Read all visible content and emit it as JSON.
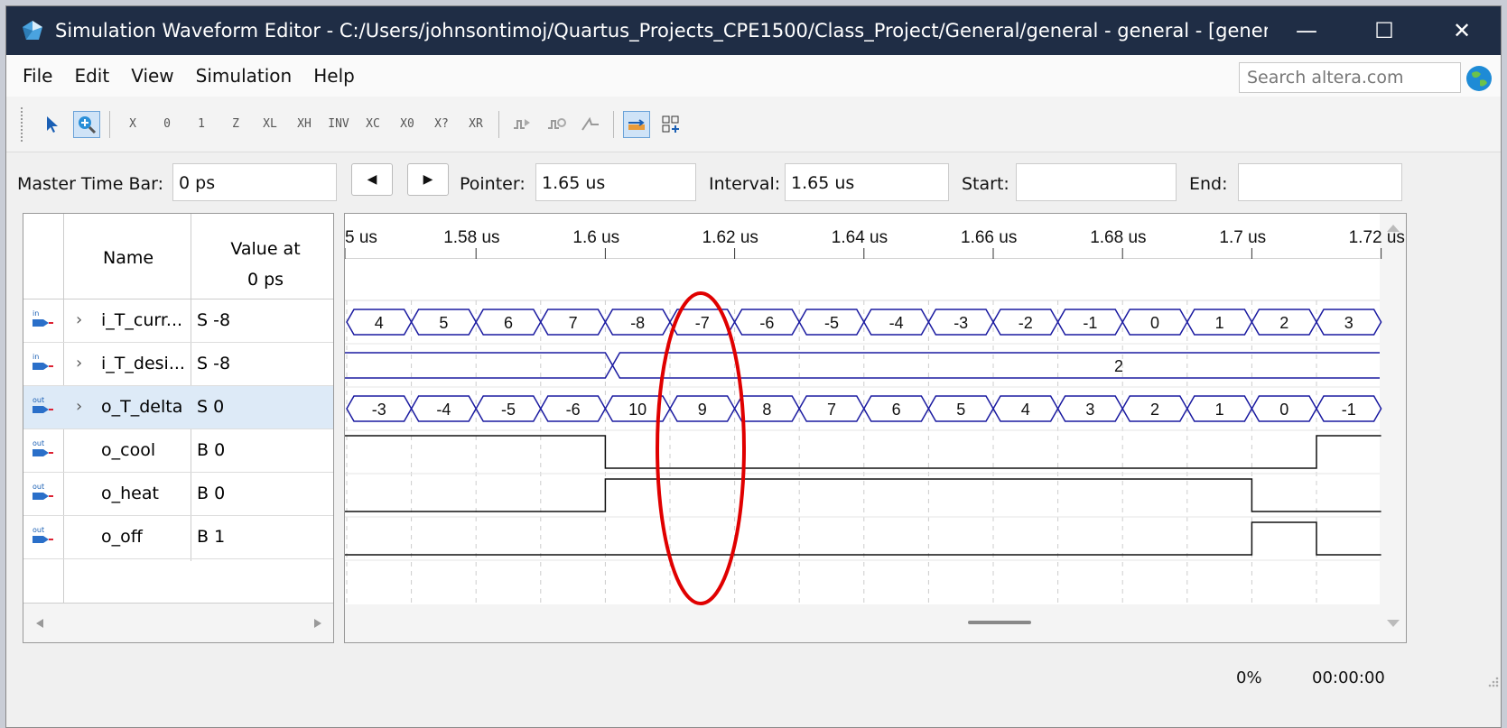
{
  "window": {
    "title": "Simulation Waveform Editor - C:/Users/johnsontimoj/Quartus_Projects_CPE1500/Class_Project/General/general - general - [general_...",
    "minimize": "—",
    "maximize": "☐",
    "close": "✕"
  },
  "menu": {
    "items": [
      "File",
      "Edit",
      "View",
      "Simulation",
      "Help"
    ],
    "search_placeholder": "Search altera.com"
  },
  "toolbar": {
    "buttons": [
      "pointer-tool",
      "zoom-tool",
      "X",
      "0",
      "1",
      "Z",
      "XL",
      "XH",
      "INV",
      "XC",
      "X0",
      "X?",
      "XR",
      "count-value",
      "clock",
      "random",
      "snap",
      "grid"
    ]
  },
  "timebar": {
    "master_label": "Master Time Bar:",
    "master_value": "0 ps",
    "prev": "◀",
    "next": "▶",
    "pointer_label": "Pointer:",
    "pointer_value": "1.65 us",
    "interval_label": "Interval:",
    "interval_value": "1.65 us",
    "start_label": "Start:",
    "start_value": "",
    "end_label": "End:",
    "end_value": ""
  },
  "table": {
    "col_name": "Name",
    "col_value_1": "Value at",
    "col_value_2": "0 ps",
    "rows": [
      {
        "dir": "in",
        "name": "i_T_curr...",
        "value": "S -8",
        "bus": true
      },
      {
        "dir": "in",
        "name": "i_T_desi...",
        "value": "S -8",
        "bus": true
      },
      {
        "dir": "out",
        "name": "o_T_delta",
        "value": "S 0",
        "bus": true
      },
      {
        "dir": "out",
        "name": "o_cool",
        "value": "B 0",
        "bus": false
      },
      {
        "dir": "out",
        "name": "o_heat",
        "value": "B 0",
        "bus": false
      },
      {
        "dir": "out",
        "name": "o_off",
        "value": "B 1",
        "bus": false
      }
    ]
  },
  "waveform": {
    "ticks": [
      "5 us",
      "1.58 us",
      "1.6 us",
      "1.62 us",
      "1.64 us",
      "1.66 us",
      "1.68 us",
      "1.7 us",
      "1.72 us"
    ],
    "i_T_curr": [
      "4",
      "5",
      "6",
      "7",
      "-8",
      "-7",
      "-6",
      "-5",
      "-4",
      "-3",
      "-2",
      "-1",
      "0",
      "1",
      "2",
      "3"
    ],
    "i_T_desi": [
      "2"
    ],
    "o_T_delta": [
      "-3",
      "-4",
      "-5",
      "-6",
      "10",
      "9",
      "8",
      "7",
      "6",
      "5",
      "4",
      "3",
      "2",
      "1",
      "0",
      "-1"
    ],
    "o_cool_levels": [
      1,
      1,
      1,
      1,
      0,
      0,
      0,
      0,
      0,
      0,
      0,
      0,
      0,
      0,
      0,
      1
    ],
    "o_heat_levels": [
      0,
      0,
      0,
      0,
      1,
      1,
      1,
      1,
      1,
      1,
      1,
      1,
      1,
      1,
      0,
      0
    ],
    "o_off_levels": [
      0,
      0,
      0,
      0,
      0,
      0,
      0,
      0,
      0,
      0,
      0,
      0,
      0,
      0,
      1,
      0
    ],
    "annotation_color": "#e00000",
    "bus_color": "#1a1aa0"
  },
  "status": {
    "progress": "0%",
    "elapsed": "00:00:00"
  }
}
